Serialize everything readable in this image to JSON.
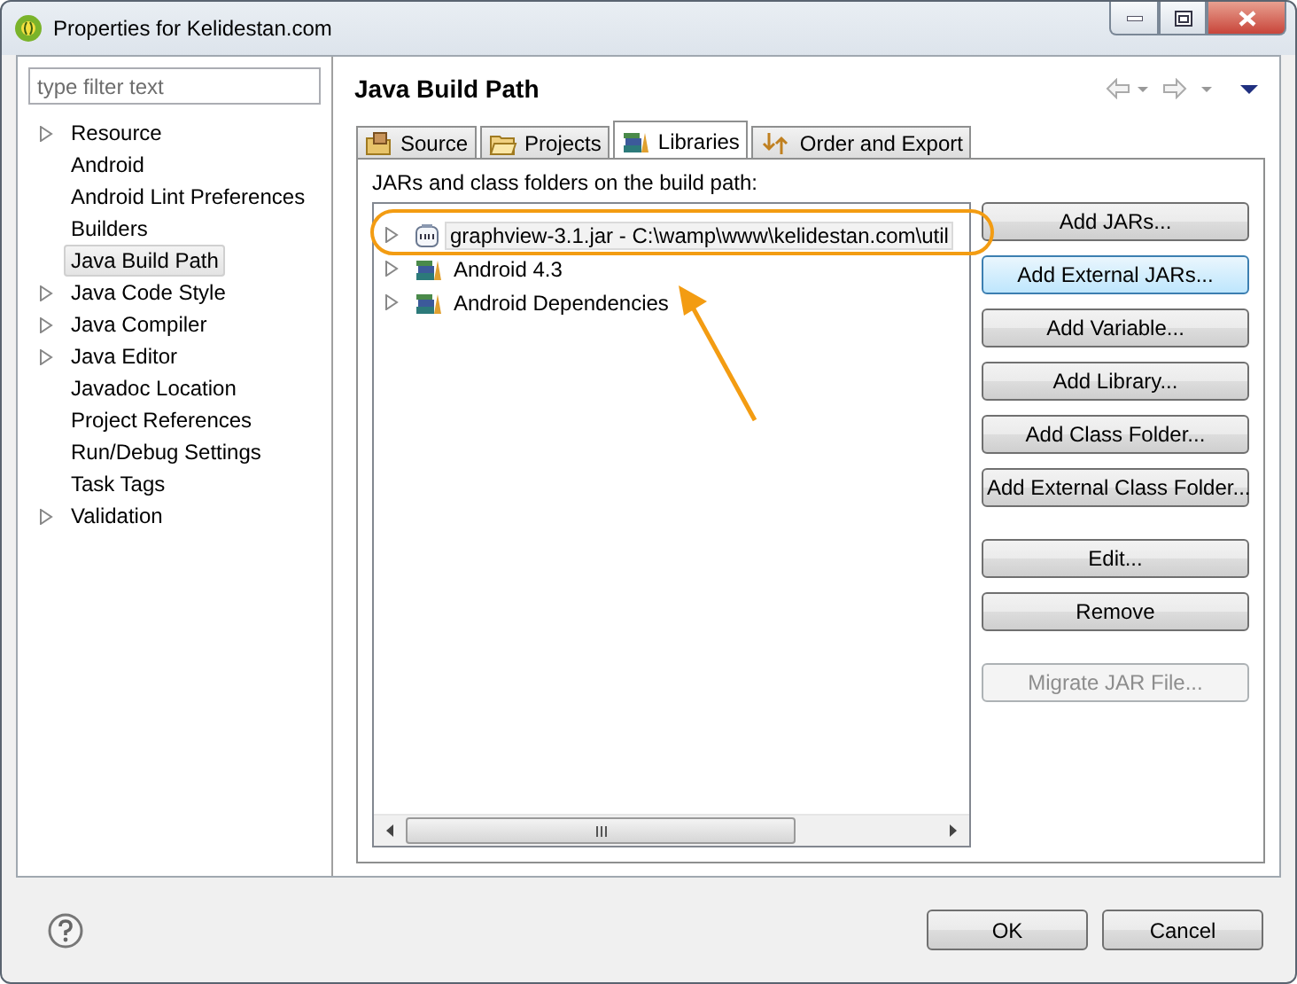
{
  "window": {
    "title": "Properties for Kelidestan.com"
  },
  "filter": {
    "placeholder": "type filter text"
  },
  "sidebar": {
    "items": [
      {
        "label": "Resource",
        "expandable": true,
        "selected": false
      },
      {
        "label": "Android",
        "expandable": false,
        "selected": false
      },
      {
        "label": "Android Lint Preferences",
        "expandable": false,
        "selected": false
      },
      {
        "label": "Builders",
        "expandable": false,
        "selected": false
      },
      {
        "label": "Java Build Path",
        "expandable": false,
        "selected": true
      },
      {
        "label": "Java Code Style",
        "expandable": true,
        "selected": false
      },
      {
        "label": "Java Compiler",
        "expandable": true,
        "selected": false
      },
      {
        "label": "Java Editor",
        "expandable": true,
        "selected": false
      },
      {
        "label": "Javadoc Location",
        "expandable": false,
        "selected": false
      },
      {
        "label": "Project References",
        "expandable": false,
        "selected": false
      },
      {
        "label": "Run/Debug Settings",
        "expandable": false,
        "selected": false
      },
      {
        "label": "Task Tags",
        "expandable": false,
        "selected": false
      },
      {
        "label": "Validation",
        "expandable": true,
        "selected": false
      }
    ]
  },
  "page": {
    "title": "Java Build Path"
  },
  "tabs": [
    {
      "label": "Source",
      "kind": "source",
      "selected": false
    },
    {
      "label": "Projects",
      "kind": "projects",
      "selected": false
    },
    {
      "label": "Libraries",
      "kind": "libraries",
      "selected": true
    },
    {
      "label": "Order and Export",
      "kind": "order",
      "selected": false
    }
  ],
  "libraries": {
    "label": "JARs and class folders on the build path:",
    "entries": [
      {
        "label": "graphview-3.1.jar - C:\\wamp\\www\\kelidestan.com\\util",
        "kind": "jar",
        "selected": true
      },
      {
        "label": "Android 4.3",
        "kind": "library",
        "selected": false
      },
      {
        "label": "Android Dependencies",
        "kind": "library",
        "selected": false
      }
    ]
  },
  "side_button_groups": [
    [
      {
        "label": "Add JARs...",
        "disabled": false,
        "focused": false
      },
      {
        "label": "Add External JARs...",
        "disabled": false,
        "focused": true
      },
      {
        "label": "Add Variable...",
        "disabled": false,
        "focused": false
      },
      {
        "label": "Add Library...",
        "disabled": false,
        "focused": false
      },
      {
        "label": "Add Class Folder...",
        "disabled": false,
        "focused": false
      },
      {
        "label": "Add External Class Folder...",
        "disabled": false,
        "focused": false
      }
    ],
    [
      {
        "label": "Edit...",
        "disabled": false,
        "focused": false
      },
      {
        "label": "Remove",
        "disabled": false,
        "focused": false
      }
    ],
    [
      {
        "label": "Migrate JAR File...",
        "disabled": true,
        "focused": false
      }
    ]
  ],
  "dialog_buttons": [
    "OK",
    "Cancel"
  ]
}
